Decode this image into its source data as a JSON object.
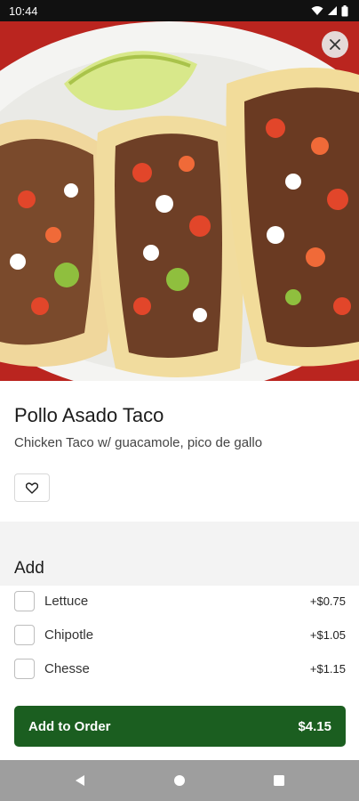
{
  "status_bar": {
    "time": "10:44",
    "icons": [
      "wifi-icon",
      "signal-icon",
      "battery-icon"
    ]
  },
  "hero": {
    "image": "tacos-photo",
    "close_icon": "close-icon"
  },
  "item": {
    "title": "Pollo Asado Taco",
    "description": "Chicken Taco w/ guacamole, pico de gallo",
    "favorite_icon": "heart-outline-icon"
  },
  "add_section": {
    "heading": "Add",
    "options": [
      {
        "label": "Lettuce",
        "price": "+$0.75",
        "checked": false
      },
      {
        "label": "Chipotle",
        "price": "+$1.05",
        "checked": false
      },
      {
        "label": "Chesse",
        "price": "+$1.15",
        "checked": false
      }
    ]
  },
  "order_button": {
    "label": "Add to Order",
    "total": "$4.15"
  },
  "nav_bar": {
    "buttons": [
      "back-icon",
      "home-icon",
      "recents-icon"
    ]
  },
  "colors": {
    "accent": "#1b5e20",
    "status_bar": "#111111",
    "nav_bar": "#9e9e9e",
    "section_bg": "#f3f3f3"
  }
}
